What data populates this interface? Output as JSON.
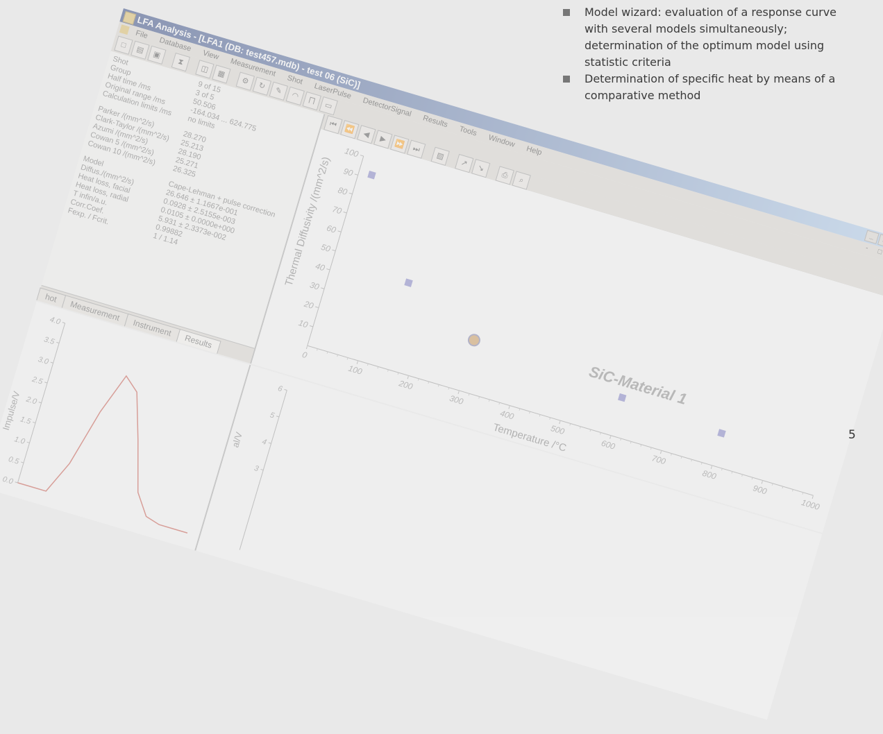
{
  "window": {
    "title": "LFA Analysis - [LFA1 (DB: test457.mdb) - test 06 (SiC)]",
    "controls": [
      "_",
      "□",
      "×"
    ]
  },
  "menu": [
    "File",
    "Database",
    "View",
    "Measurement",
    "Shot",
    "LaserPulse",
    "DetectorSignal",
    "Results",
    "Tools",
    "Window",
    "Help"
  ],
  "mdi_controls": "- □ ×",
  "params": [
    {
      "label": "Shot",
      "value": "9 of 15"
    },
    {
      "label": "Group",
      "value": "3 of 5"
    },
    {
      "label": "Half time /ms",
      "value": "50.506"
    },
    {
      "label": "Original range /ms",
      "value": "-164.034 ... 624.775"
    },
    {
      "label": "Calculation limits /ms",
      "value": "no limits"
    },
    {
      "label": "Parker /(mm^2/s)",
      "value": "28.270"
    },
    {
      "label": "Clark-Taylor /(mm^2/s)",
      "value": "25.213"
    },
    {
      "label": "Azumi /(mm^2/s)",
      "value": "28.190"
    },
    {
      "label": "Cowan 5 /(mm^2/s)",
      "value": "25.271"
    },
    {
      "label": "Cowan 10 /(mm^2/s)",
      "value": "26.325"
    },
    {
      "label": "Model",
      "value": "Cape-Lehman + pulse correction"
    },
    {
      "label": "Diffus./(mm^2/s)",
      "value": "26.646 ± 1.1667e-001"
    },
    {
      "label": "Heat loss, facial",
      "value": "0.0928 ± 2.5155e-003"
    },
    {
      "label": "Heat loss, radial",
      "value": "0.0105 ± 0.0000e+000"
    },
    {
      "label": "T infin/a.u.",
      "value": "5.931 ± 2.3373e-002"
    },
    {
      "label": "Corr.Coef.",
      "value": "0.99882"
    },
    {
      "label": "Fexp. / Fcrit.",
      "value": "1 / 1.14"
    }
  ],
  "tabs": [
    "hot",
    "Measurement",
    "Instrument",
    "Results"
  ],
  "chart_data": [
    {
      "type": "scatter",
      "xlabel": "Temperature /°C",
      "ylabel": "Thermal Diffusivity /(mm^2/s)",
      "xlim": [
        0,
        1000
      ],
      "ylim": [
        0,
        100
      ],
      "xticks": [
        0,
        100,
        200,
        300,
        400,
        500,
        600,
        700,
        800,
        900,
        1000
      ],
      "yticks": [
        10,
        20,
        30,
        40,
        50,
        60,
        70,
        80,
        90,
        100
      ],
      "annotation": "SiC-Material 1",
      "points": [
        {
          "x": 25,
          "y": 92
        },
        {
          "x": 150,
          "y": 45
        },
        {
          "x": 300,
          "y": 26.6,
          "highlight": true
        },
        {
          "x": 600,
          "y": 20
        },
        {
          "x": 800,
          "y": 17
        }
      ]
    },
    {
      "type": "line",
      "ylabel": "Impulse/V",
      "ylim": [
        0,
        4
      ],
      "yticks": [
        "0.0",
        "0.5",
        "1.0",
        "1.5",
        "2.0",
        "2.5",
        "3.0",
        "3.5",
        "4.0"
      ],
      "x": [
        0,
        1,
        2,
        3,
        4,
        5,
        6,
        7,
        8,
        9,
        10,
        11,
        12
      ],
      "y": [
        0,
        0,
        0,
        0.8,
        2.2,
        3.2,
        2.9,
        1.8,
        0.6,
        0.1,
        0,
        0,
        0
      ]
    },
    {
      "type": "line",
      "ylabel": "al/V",
      "ylim": [
        0,
        6
      ],
      "yticks": [
        "3",
        "4",
        "5",
        "6"
      ],
      "x": [],
      "y": []
    }
  ],
  "slide": {
    "bullets": [
      "Model wizard: evaluation of a response curve with several models simultaneously; determination of the optimum model using statistic criteria",
      "Determination of specific heat by means of a comparative method"
    ],
    "page_number": "5"
  }
}
